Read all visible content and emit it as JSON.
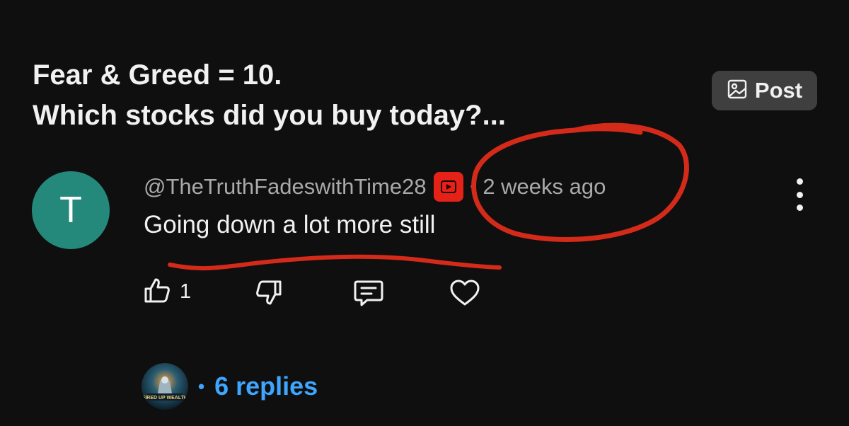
{
  "post": {
    "title_line1": "Fear & Greed = 10.",
    "title_line2": "Which stocks did you buy today?...",
    "post_button_label": "Post"
  },
  "comment": {
    "avatar_letter": "T",
    "author": "@TheTruthFadeswithTime28",
    "separator": "•",
    "time": "2 weeks ago",
    "text": "Going down a lot more still",
    "like_count": "1"
  },
  "replies": {
    "count_label": "6 replies",
    "separator": "•",
    "avatar_text": "FIRED UP WEALTH"
  },
  "colors": {
    "background": "#0f0f0f",
    "avatar_bg": "#24897a",
    "youtube_red": "#e62117",
    "link_blue": "#3ea6ff",
    "annotation_red": "#d42a1a"
  },
  "icons": [
    "image-icon",
    "youtube-icon",
    "more-vert-icon",
    "thumb-up-icon",
    "thumb-down-icon",
    "reply-icon",
    "heart-icon"
  ]
}
